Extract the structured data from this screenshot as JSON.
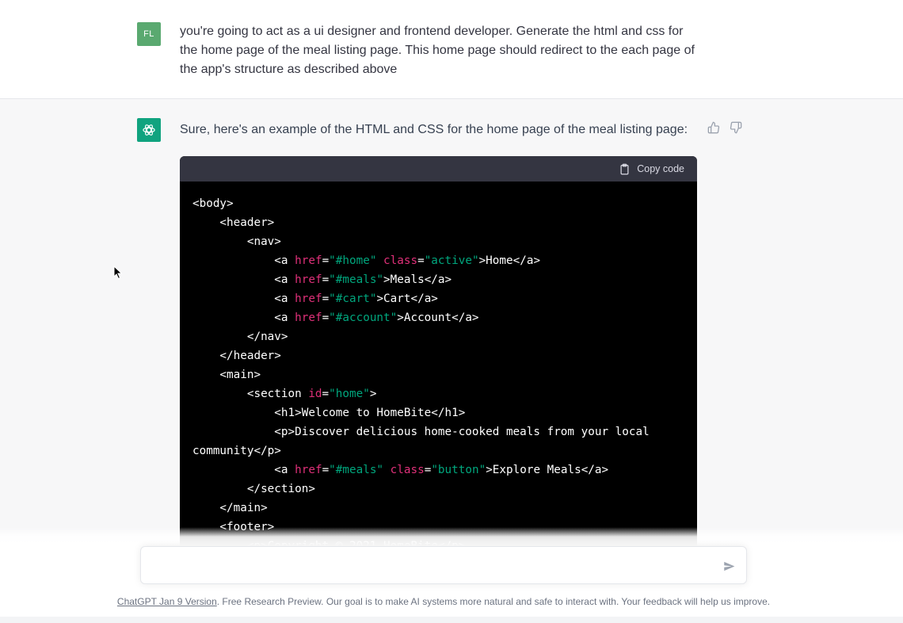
{
  "user_message": {
    "avatar_initials": "FL",
    "text": "you're going to act as a ui designer and frontend developer. Generate the html and css for the home page of the meal listing page. This home page should redirect to the each page of the app's structure as described above"
  },
  "assistant_message": {
    "intro": "Sure, here's an example of the HTML and CSS for the home page of the meal listing page:",
    "copy_label": "Copy code",
    "code_lines": [
      [
        {
          "t": "<body>",
          "c": "p"
        }
      ],
      [
        {
          "t": "    <header>",
          "c": "p"
        }
      ],
      [
        {
          "t": "        <nav>",
          "c": "p"
        }
      ],
      [
        {
          "t": "            <a ",
          "c": "p"
        },
        {
          "t": "href",
          "c": "a"
        },
        {
          "t": "=",
          "c": "p"
        },
        {
          "t": "\"#home\"",
          "c": "s"
        },
        {
          "t": " ",
          "c": "p"
        },
        {
          "t": "class",
          "c": "a"
        },
        {
          "t": "=",
          "c": "p"
        },
        {
          "t": "\"active\"",
          "c": "s"
        },
        {
          "t": ">Home</a>",
          "c": "p"
        }
      ],
      [
        {
          "t": "            <a ",
          "c": "p"
        },
        {
          "t": "href",
          "c": "a"
        },
        {
          "t": "=",
          "c": "p"
        },
        {
          "t": "\"#meals\"",
          "c": "s"
        },
        {
          "t": ">Meals</a>",
          "c": "p"
        }
      ],
      [
        {
          "t": "            <a ",
          "c": "p"
        },
        {
          "t": "href",
          "c": "a"
        },
        {
          "t": "=",
          "c": "p"
        },
        {
          "t": "\"#cart\"",
          "c": "s"
        },
        {
          "t": ">Cart</a>",
          "c": "p"
        }
      ],
      [
        {
          "t": "            <a ",
          "c": "p"
        },
        {
          "t": "href",
          "c": "a"
        },
        {
          "t": "=",
          "c": "p"
        },
        {
          "t": "\"#account\"",
          "c": "s"
        },
        {
          "t": ">Account</a>",
          "c": "p"
        }
      ],
      [
        {
          "t": "        </nav>",
          "c": "p"
        }
      ],
      [
        {
          "t": "    </header>",
          "c": "p"
        }
      ],
      [
        {
          "t": "    <main>",
          "c": "p"
        }
      ],
      [
        {
          "t": "        <section ",
          "c": "p"
        },
        {
          "t": "id",
          "c": "a"
        },
        {
          "t": "=",
          "c": "p"
        },
        {
          "t": "\"home\"",
          "c": "s"
        },
        {
          "t": ">",
          "c": "p"
        }
      ],
      [
        {
          "t": "            <h1>Welcome to HomeBite</h1>",
          "c": "p"
        }
      ],
      [
        {
          "t": "            <p>Discover delicious home-cooked meals from your local",
          "c": "p"
        }
      ],
      [
        {
          "t": "community</p>",
          "c": "p"
        }
      ],
      [
        {
          "t": "            <a ",
          "c": "p"
        },
        {
          "t": "href",
          "c": "a"
        },
        {
          "t": "=",
          "c": "p"
        },
        {
          "t": "\"#meals\"",
          "c": "s"
        },
        {
          "t": " ",
          "c": "p"
        },
        {
          "t": "class",
          "c": "a"
        },
        {
          "t": "=",
          "c": "p"
        },
        {
          "t": "\"button\"",
          "c": "s"
        },
        {
          "t": ">Explore Meals</a>",
          "c": "p"
        }
      ],
      [
        {
          "t": "        </section>",
          "c": "p"
        }
      ],
      [
        {
          "t": "    </main>",
          "c": "p"
        }
      ],
      [
        {
          "t": "    <footer>",
          "c": "p"
        }
      ],
      [
        {
          "t": "        <p>Copyright © 2021 HomeBite</p>",
          "c": "p"
        }
      ]
    ]
  },
  "composer": {
    "placeholder": ""
  },
  "footer": {
    "version_link": "ChatGPT Jan 9 Version",
    "note": ". Free Research Preview. Our goal is to make AI systems more natural and safe to interact with. Your feedback will help us improve."
  },
  "icons": {
    "thumbs_up": "thumbs-up-icon",
    "thumbs_down": "thumbs-down-icon",
    "clipboard": "clipboard-icon",
    "send": "send-icon",
    "openai_logo": "openai-logo-icon"
  },
  "colors": {
    "user_avatar": "#5aa970",
    "assistant_avatar": "#10a37f",
    "code_bg": "#000000",
    "code_header": "#343541",
    "attr": "#df3079",
    "string": "#00a67d"
  }
}
